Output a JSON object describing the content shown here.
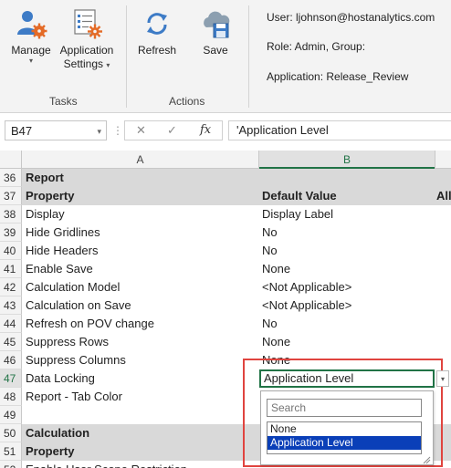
{
  "ribbon": {
    "buttons": [
      {
        "label": "Manage",
        "icon": "manage-user-gear-icon",
        "caret": "▾"
      },
      {
        "label": "Application",
        "label2": "Settings",
        "icon": "application-settings-icon",
        "caret": "▾"
      },
      {
        "label": "Refresh",
        "icon": "refresh-icon"
      },
      {
        "label": "Save",
        "icon": "cloud-save-icon"
      }
    ],
    "groups": {
      "tasks": "Tasks",
      "actions": "Actions"
    },
    "info": {
      "user": "User: ljohnson@hostanalytics.com",
      "role": "Role: Admin, Group:",
      "application": "Application: Release_Review"
    }
  },
  "formula_bar": {
    "name_box": "B47",
    "cancel_symbol": "✕",
    "enter_symbol": "✓",
    "fx": "fx",
    "content": "'Application Level"
  },
  "columns": [
    "A",
    "B"
  ],
  "rows": [
    {
      "num": "36",
      "a": "Report",
      "b": "",
      "c": "",
      "style": "header"
    },
    {
      "num": "37",
      "a": "Property",
      "b": "Default Value",
      "c": "All",
      "style": "subheader"
    },
    {
      "num": "38",
      "a": "Display",
      "b": "Display Label",
      "c": ""
    },
    {
      "num": "39",
      "a": "Hide Gridlines",
      "b": "No",
      "c": ""
    },
    {
      "num": "40",
      "a": "Hide Headers",
      "b": "No",
      "c": ""
    },
    {
      "num": "41",
      "a": "Enable Save",
      "b": "None",
      "c": ""
    },
    {
      "num": "42",
      "a": "Calculation Model",
      "b": "<Not Applicable>",
      "c": ""
    },
    {
      "num": "43",
      "a": "Calculation on Save",
      "b": "<Not Applicable>",
      "c": ""
    },
    {
      "num": "44",
      "a": "Refresh on POV change",
      "b": "No",
      "c": ""
    },
    {
      "num": "45",
      "a": "Suppress Rows",
      "b": "None",
      "c": ""
    },
    {
      "num": "46",
      "a": "Suppress Columns",
      "b": "None",
      "c": ""
    },
    {
      "num": "47",
      "a": "Data Locking",
      "b": "Application Level",
      "c": "",
      "style": "active"
    },
    {
      "num": "48",
      "a": "Report - Tab Color",
      "b": "",
      "c": ""
    },
    {
      "num": "49",
      "a": "",
      "b": "",
      "c": ""
    },
    {
      "num": "50",
      "a": "Calculation",
      "b": "",
      "c": "",
      "style": "header"
    },
    {
      "num": "51",
      "a": "Property",
      "b": "",
      "c": "",
      "style": "subheader"
    },
    {
      "num": "52",
      "a": "Enable User Scope Restriction",
      "b": "",
      "c": ""
    }
  ],
  "dropdown": {
    "search_placeholder": "Search",
    "options": [
      "None",
      "Application Level"
    ],
    "selected": "Application Level",
    "arrow": "▾"
  },
  "colors": {
    "highlight_box": "#e0443f",
    "selection": "#0a3fb8",
    "active_cell_border": "#217346",
    "header_fill": "#d9d9d9"
  }
}
